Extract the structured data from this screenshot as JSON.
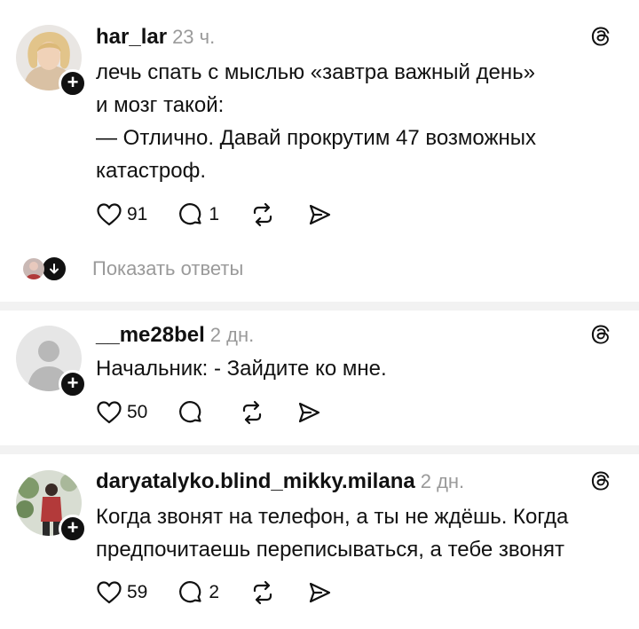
{
  "posts": [
    {
      "username": "har_lar",
      "time": "23 ч.",
      "lines": [
        "лечь спать с мыслью «завтра важный день»",
        "и мозг такой:",
        "— Отлично. Давай прокрутим 47 возможных",
        "катастроф."
      ],
      "likes": "91",
      "comments": "1"
    },
    {
      "username": "__me28bel",
      "time": "2 дн.",
      "lines": [
        "Начальник: - Зайдите ко мне."
      ],
      "likes": "50",
      "comments": ""
    },
    {
      "username": "daryatalyko.blind_mikky.milana",
      "time": "2 дн.",
      "lines": [
        "Когда звонят на телефон, а ты не ждёшь. Когда",
        "предпочитаешь переписываться, а тебе звонят"
      ],
      "likes": "59",
      "comments": "2"
    }
  ],
  "replies_link": "Показать ответы",
  "icons": {
    "like": "heart-icon",
    "comment": "comment-icon",
    "repost": "repost-icon",
    "share": "share-icon",
    "threads": "threads-logo-icon",
    "follow": "plus-icon",
    "expand": "chevron-down-icon"
  }
}
